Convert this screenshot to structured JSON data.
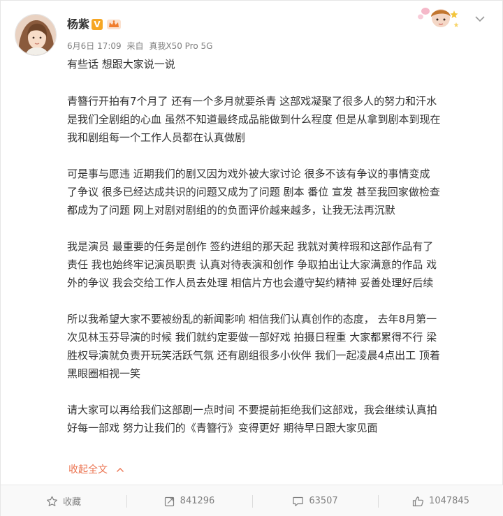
{
  "user": {
    "name": "杨紫",
    "vip_badge": "V",
    "date": "6月6日 17:09",
    "source_prefix": "来自",
    "source": "真我X50 Pro 5G"
  },
  "post": {
    "paragraphs": [
      [
        "有些话 想跟大家说一说"
      ],
      [
        "青簪行开拍有7个月了 还有一个多月就要杀青 这部戏凝聚了很多人的努力和汗水",
        "是我们全剧组的心血 虽然不知道最终成品能做到什么程度 但是从拿到剧本到现在",
        "我和剧组每一个工作人员都在认真做剧"
      ],
      [
        "可是事与愿违  近期我们的剧又因为戏外被大家讨论 很多不该有争议的事情变成",
        "了争议 很多已经达成共识的问题又成为了问题  剧本 番位 宣发 甚至我回家做检查",
        "都成为了问题  网上对剧对剧组的的负面评价越来越多，让我无法再沉默"
      ],
      [
        "我是演员  最重要的任务是创作  签约进组的那天起 我就对黄梓瑕和这部作品有了",
        "责任  我也始终牢记演员职责 认真对待表演和创作 争取拍出让大家满意的作品  戏",
        "外的争议 我会交给工作人员去处理 相信片方也会遵守契约精神 妥善处理好后续"
      ],
      [
        "所以我希望大家不要被纷乱的新闻影响  相信我们认真创作的态度，  去年8月第一",
        "次见林玉芬导演的时候 我们就约定要做一部好戏 拍摄日程重  大家都累得不行  梁",
        "胜权导演就负责开玩笑活跃气氛  还有剧组很多小伙伴  我们一起凌晨4点出工  顶着",
        "黑眼圈相视一笑"
      ],
      [
        "请大家可以再给我们这部剧一点时间  不要提前拒绝我们这部戏，我会继续认真拍",
        "好每一部戏  努力让我们的《青簪行》变得更好   期待早日跟大家见面"
      ]
    ],
    "collapse_label": "收起全文"
  },
  "actions": {
    "favorite_label": "收藏",
    "repost_count": "841296",
    "comment_count": "63507",
    "like_count": "1047845"
  },
  "icons": {
    "avatar": "avatar-photo",
    "crown": "crown-icon",
    "decor": "cartoon-decoration",
    "menu": "chevron-down-icon",
    "favorite": "star-icon",
    "repost": "repost-icon",
    "comment": "comment-icon",
    "like": "thumbs-up-icon"
  },
  "colors": {
    "link": "#eb7350",
    "vip": "#f6a623",
    "meta": "#808080",
    "text": "#333333"
  }
}
